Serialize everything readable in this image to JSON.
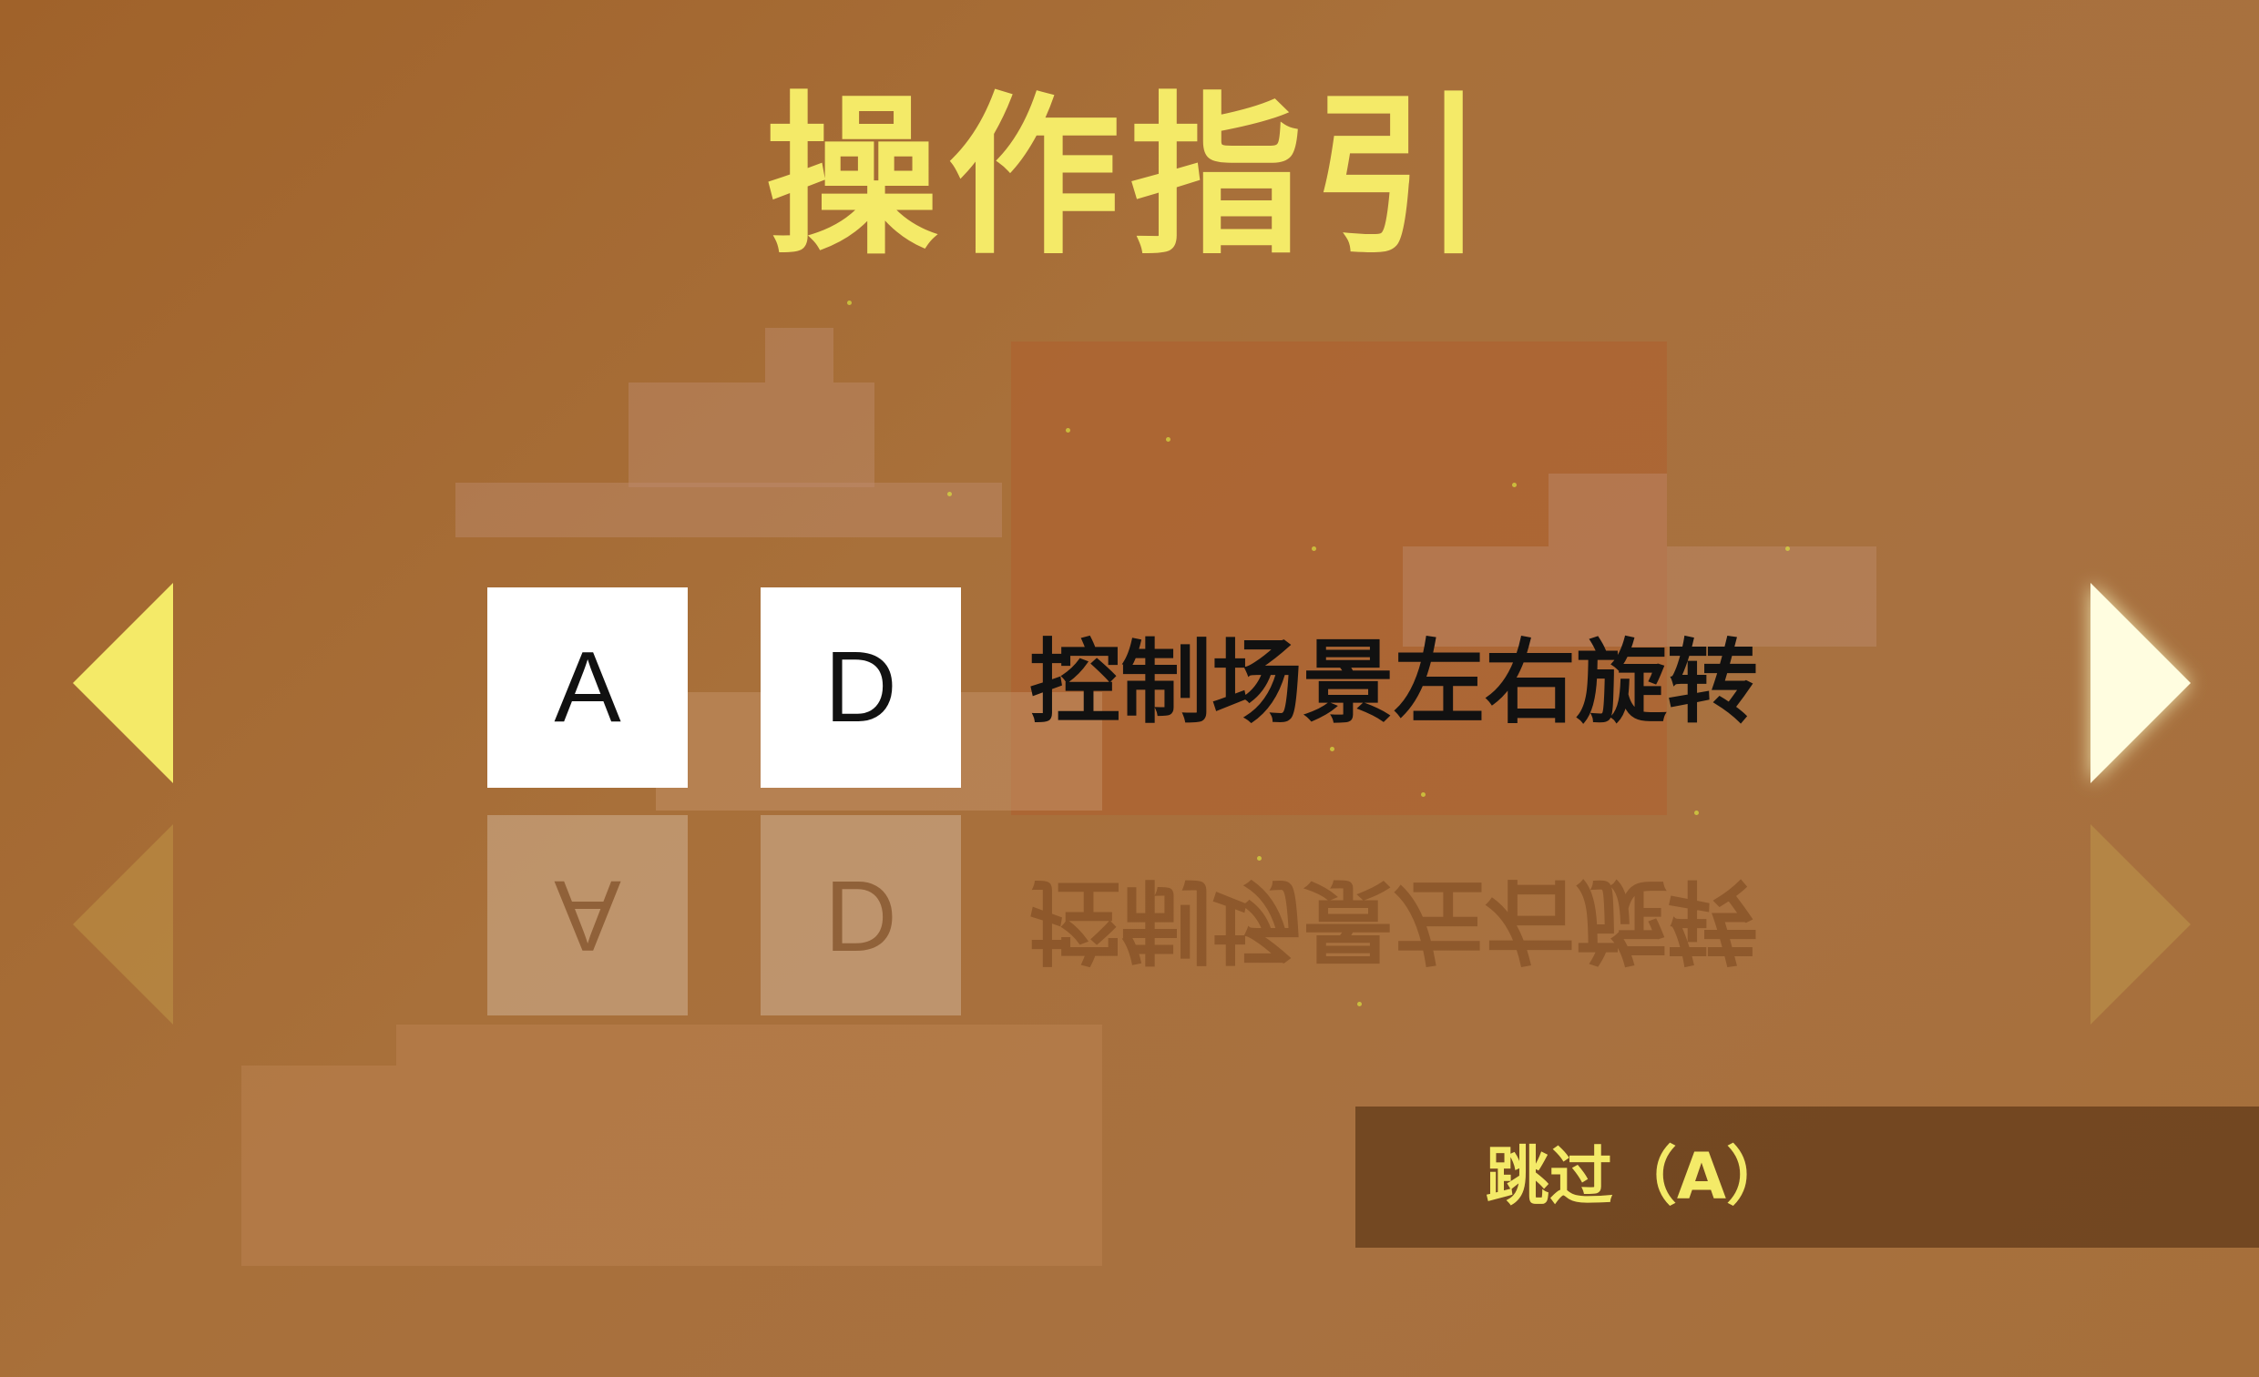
{
  "title": "操作指引",
  "controls": {
    "keys": [
      "A",
      "D"
    ],
    "description": "控制场景左右旋转"
  },
  "nav": {
    "prev_icon": "triangle-left-icon",
    "next_icon": "triangle-right-icon"
  },
  "skip": {
    "label": "跳过（A）"
  },
  "colors": {
    "accent_yellow": "#f4ea68",
    "background": "#a8703a",
    "key_bg": "#ffffff",
    "skip_bar": "#643c19"
  }
}
